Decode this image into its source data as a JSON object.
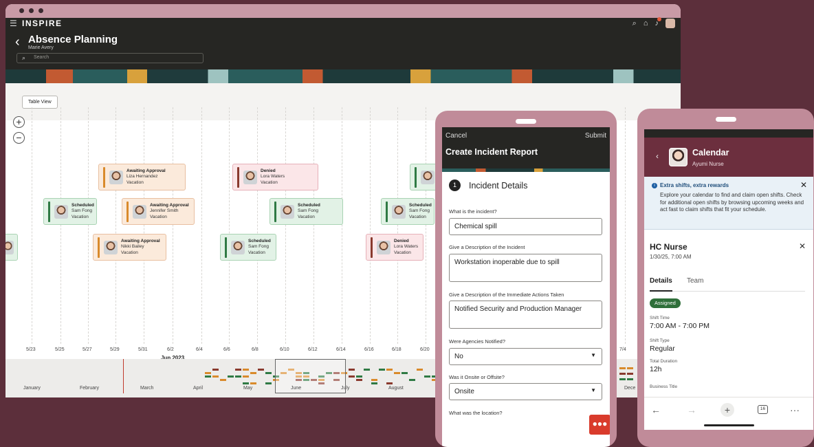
{
  "app": {
    "brand": "INSPIRE",
    "title": "Absence Planning",
    "subtitle": "Marie Avery",
    "search_placeholder": "Search"
  },
  "toolbar": {
    "table_view_label": "Table View"
  },
  "gantt": {
    "cards": [
      {
        "status": "Awaiting Approval",
        "name": "Liza Hernandez",
        "type": "Vacation",
        "kind": "approval"
      },
      {
        "status": "Denied",
        "name": "Lora Waters",
        "type": "Vacation",
        "kind": "denied"
      },
      {
        "status": "Scheduled",
        "name": "Sam Fong",
        "type": "Vacation",
        "kind": "scheduled"
      },
      {
        "status": "Awaiting Approval",
        "name": "Jennifer Smith",
        "type": "Vacation",
        "kind": "approval"
      },
      {
        "status": "Scheduled",
        "name": "Sam Fong",
        "type": "Vacation",
        "kind": "scheduled"
      },
      {
        "status": "Scheduled",
        "name": "Sam Fong",
        "type": "Vacation",
        "kind": "scheduled"
      },
      {
        "status": "Awaiting Approval",
        "name": "Nikki Bailey",
        "type": "Vacation",
        "kind": "approval"
      },
      {
        "status": "Scheduled",
        "name": "Sam Fong",
        "type": "Vacation",
        "kind": "scheduled"
      },
      {
        "status": "Denied",
        "name": "Lora Waters",
        "type": "Vacation",
        "kind": "denied"
      }
    ],
    "dates": [
      "5/23",
      "5/25",
      "5/27",
      "5/29",
      "5/31",
      "6/2",
      "6/4",
      "6/6",
      "6/8",
      "6/10",
      "6/12",
      "6/14",
      "6/16",
      "6/18",
      "6/20",
      "7/4"
    ],
    "month_label": "Jun 2023",
    "overview_months": [
      "January",
      "February",
      "March",
      "April",
      "May",
      "June",
      "July",
      "August",
      "Dece"
    ]
  },
  "incident": {
    "cancel": "Cancel",
    "submit": "Submit",
    "title": "Create Incident Report",
    "step_num": "1",
    "step_label": "Incident Details",
    "q1": "What is the incident?",
    "a1": "Chemical spill",
    "q2": "Give a Description of the Incident",
    "a2": "Workstation inoperable due to spill",
    "q3": "Give a Description of the Immediate Actions Taken",
    "a3": "Notified Security and Production Manager",
    "q4": "Were Agencies Notified?",
    "a4": "No",
    "q5": "Was it Onsite or Offsite?",
    "a5": "Onsite",
    "q6": "What was the location?"
  },
  "calendar": {
    "title": "Calendar",
    "user": "Ayumi Nurse",
    "info_title": "Extra shifts, extra rewards",
    "info_body": "Explore your calendar to find and claim open shifts. Check for additional open shifts by browsing upcoming weeks and act fast to claim shifts that fit your schedule.",
    "shift_title": "HC Nurse",
    "shift_date": "1/30/25, 7:00 AM",
    "tab_details": "Details",
    "tab_team": "Team",
    "status": "Assigned",
    "time_label": "Shift Time",
    "time_value": "7:00 AM - 7:00 PM",
    "type_label": "Shift Type",
    "type_value": "Regular",
    "dur_label": "Total Duration",
    "dur_value": "12h",
    "biz_label": "Business Title",
    "tab_count": "16"
  },
  "colors": {
    "approval": "#d98a2b",
    "scheduled": "#2f7a44",
    "denied": "#8a3a2e",
    "brand_maroon": "#6c2f3e"
  }
}
